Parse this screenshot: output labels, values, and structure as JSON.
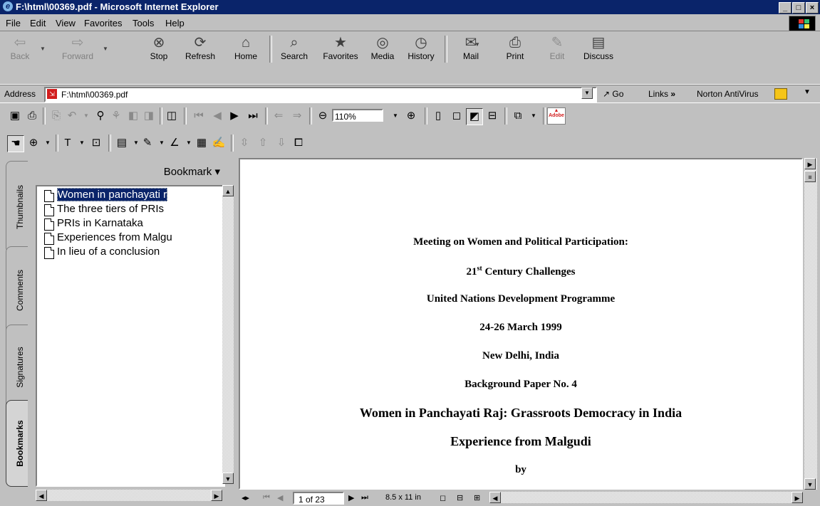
{
  "window": {
    "title": "F:\\html\\00369.pdf - Microsoft Internet Explorer"
  },
  "menu": [
    {
      "label": "File"
    },
    {
      "label": "Edit"
    },
    {
      "label": "View"
    },
    {
      "label": "Favorites"
    },
    {
      "label": "Tools"
    },
    {
      "label": "Help"
    }
  ],
  "toolbar": {
    "back": "Back",
    "forward": "Forward",
    "stop": "Stop",
    "refresh": "Refresh",
    "home": "Home",
    "search": "Search",
    "favorites": "Favorites",
    "media": "Media",
    "history": "History",
    "mail": "Mail",
    "print": "Print",
    "edit": "Edit",
    "discuss": "Discuss"
  },
  "address": {
    "label": "Address",
    "url": "F:\\html\\00369.pdf",
    "go": "Go",
    "links": "Links",
    "norton": "Norton AntiVirus"
  },
  "acrobat": {
    "zoom": "110%"
  },
  "nav": {
    "tabs": [
      "Thumbnails",
      "Comments",
      "Signatures",
      "Bookmarks"
    ],
    "active_tab": "Bookmarks",
    "bookmark_menu": "Bookmark ▾",
    "bookmarks": [
      {
        "label": "Women in panchayati r",
        "selected": true
      },
      {
        "label": "The three tiers of PRIs"
      },
      {
        "label": "PRIs in Karnataka"
      },
      {
        "label": "Experiences from Malgu"
      },
      {
        "label": "In lieu of a conclusion"
      }
    ]
  },
  "document": {
    "lines": [
      "Meeting on Women and Political Participation:",
      "21",
      "st",
      "Century Challenges",
      "United Nations Development Programme",
      "24-26 March 1999",
      "New Delhi, India",
      "Background Paper No. 4",
      "Women in Panchayati Raj: Grassroots Democracy in India",
      "Experience from Malgudi",
      "by"
    ]
  },
  "status": {
    "page": "1 of 23",
    "size": "8.5 x 11 in"
  }
}
